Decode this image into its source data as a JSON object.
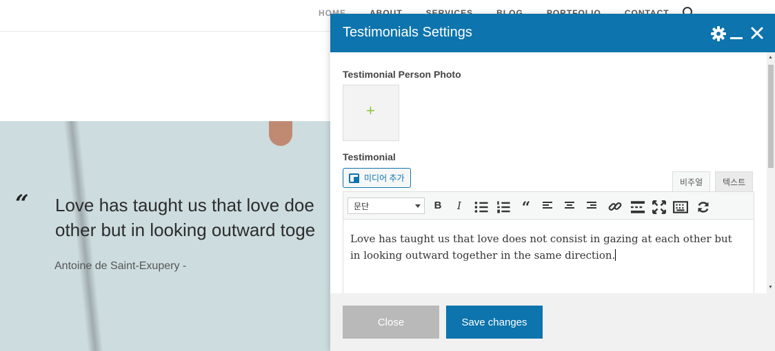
{
  "nav": {
    "items": [
      "HOME",
      "ABOUT",
      "SERVICES",
      "BLOG",
      "PORTFOLIO",
      "CONTACT"
    ],
    "search_icon": "search-icon"
  },
  "hero": {
    "quote_mark": "“",
    "quote": "Love has taught us that love doe\nother but in looking outward toge",
    "author": "Antoine de Saint-Exupery -"
  },
  "modal": {
    "title": "Testimonials Settings",
    "header_icons": [
      "gear-icon",
      "minimize-icon",
      "close-icon"
    ],
    "photo_label": "Testimonial Person Photo",
    "photo_add": "+",
    "testimonial_label": "Testimonial",
    "media_button": "미디어 추가",
    "tabs": {
      "visual": "비주얼",
      "text": "텍스트"
    },
    "format_select": "문단",
    "toolbar_icons": [
      "bold-icon",
      "italic-icon",
      "bullet-list-icon",
      "numbered-list-icon",
      "blockquote-icon",
      "align-left-icon",
      "align-center-icon",
      "align-right-icon",
      "link-icon",
      "read-more-icon",
      "fullscreen-icon",
      "keyboard-icon",
      "refresh-icon"
    ],
    "content": "Love has taught us that love does not consist in gazing at each other but in looking outward together in the same direction.",
    "close_button": "Close",
    "save_button": "Save changes"
  },
  "colors": {
    "accent": "#0d74ad",
    "hero_bg": "#cddcdf",
    "close_btn": "#b9b9b9",
    "plus": "#8cc63f"
  }
}
